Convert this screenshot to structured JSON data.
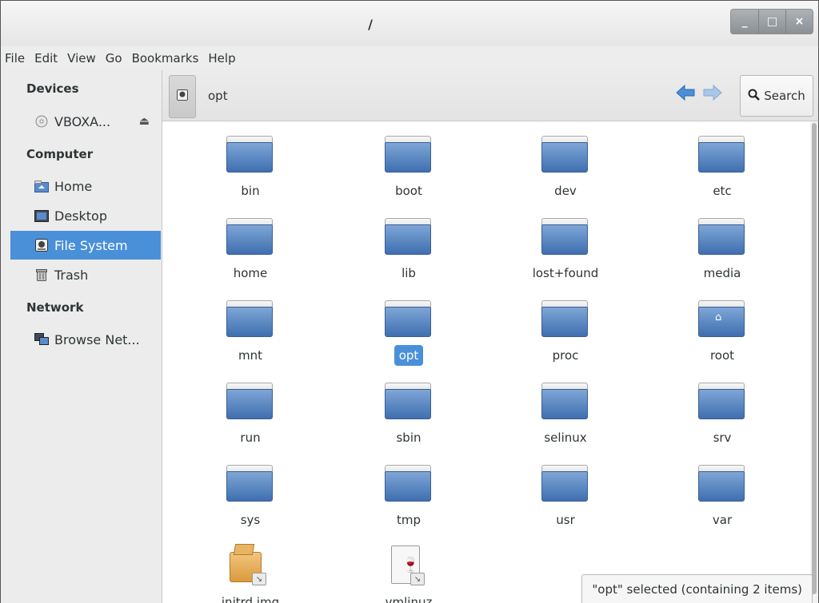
{
  "window": {
    "title": "/",
    "controls": {
      "minimize": "_",
      "maximize": "□",
      "close": "×"
    }
  },
  "menubar": [
    "File",
    "Edit",
    "View",
    "Go",
    "Bookmarks",
    "Help"
  ],
  "sidebar": {
    "devices_heading": "Devices",
    "device": {
      "label": "VBOXA...",
      "icon": "cd-icon",
      "eject": "⏏"
    },
    "computer_heading": "Computer",
    "items": [
      {
        "label": "Home",
        "icon": "home-icon"
      },
      {
        "label": "Desktop",
        "icon": "desktop-icon"
      },
      {
        "label": "File System",
        "icon": "harddisk-icon",
        "selected": true
      },
      {
        "label": "Trash",
        "icon": "trash-icon"
      }
    ],
    "network_heading": "Network",
    "network_item": {
      "label": "Browse Net...",
      "icon": "network-icon"
    }
  },
  "toolbar": {
    "path_label": "opt",
    "search_label": "Search",
    "accent": "#4a90d9"
  },
  "content": {
    "items": [
      {
        "name": "bin",
        "type": "folder"
      },
      {
        "name": "boot",
        "type": "folder"
      },
      {
        "name": "dev",
        "type": "folder"
      },
      {
        "name": "etc",
        "type": "folder"
      },
      {
        "name": "home",
        "type": "folder"
      },
      {
        "name": "lib",
        "type": "folder"
      },
      {
        "name": "lost+found",
        "type": "folder"
      },
      {
        "name": "media",
        "type": "folder"
      },
      {
        "name": "mnt",
        "type": "folder"
      },
      {
        "name": "opt",
        "type": "folder",
        "selected": true
      },
      {
        "name": "proc",
        "type": "folder"
      },
      {
        "name": "root",
        "type": "folder-home"
      },
      {
        "name": "run",
        "type": "folder"
      },
      {
        "name": "sbin",
        "type": "folder"
      },
      {
        "name": "selinux",
        "type": "folder"
      },
      {
        "name": "srv",
        "type": "folder"
      },
      {
        "name": "sys",
        "type": "folder"
      },
      {
        "name": "tmp",
        "type": "folder"
      },
      {
        "name": "usr",
        "type": "folder"
      },
      {
        "name": "var",
        "type": "folder"
      },
      {
        "name": "initrd.img",
        "type": "package-link"
      },
      {
        "name": "vmlinuz",
        "type": "executable-link"
      }
    ]
  },
  "status": {
    "text": "\"opt\" selected (containing 2 items)"
  }
}
